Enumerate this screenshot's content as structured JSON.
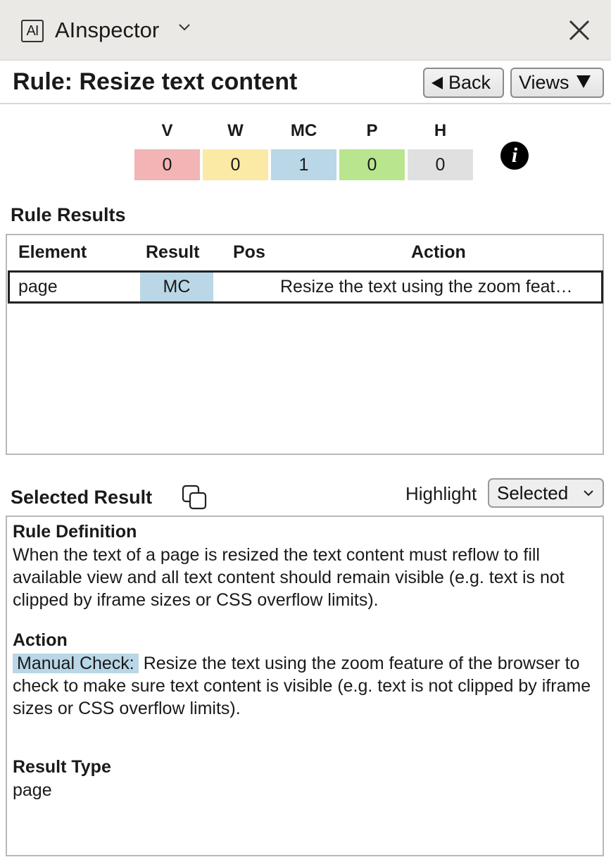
{
  "titlebar": {
    "logo_text": "AI",
    "app_name": "AInspector"
  },
  "header": {
    "title": "Rule: Resize text content",
    "back_label": "Back",
    "views_label": "Views"
  },
  "summary": [
    {
      "label": "V",
      "value": "0",
      "color": "#f2b4b4"
    },
    {
      "label": "W",
      "value": "0",
      "color": "#fbe9a6"
    },
    {
      "label": "MC",
      "value": "1",
      "color": "#b9d7e6"
    },
    {
      "label": "P",
      "value": "0",
      "color": "#b9e58e"
    },
    {
      "label": "H",
      "value": "0",
      "color": "#e0e0e0"
    }
  ],
  "rule_results": {
    "heading": "Rule Results",
    "columns": [
      "Element",
      "Result",
      "Pos",
      "Action"
    ],
    "rows": [
      {
        "element": "page",
        "result": "MC",
        "pos": "",
        "action": "Resize the text using the zoom feat…"
      }
    ]
  },
  "selected_result": {
    "heading": "Selected Result",
    "highlight_label": "Highlight",
    "highlight_value": "Selected"
  },
  "detail": {
    "rule_definition_heading": "Rule Definition",
    "rule_definition_text": "When the text of a page is resized the text content must reflow to fill available view and all text content should remain visible (e.g. text is not clipped by iframe sizes or CSS overflow limits).",
    "action_heading": "Action",
    "action_tag": "Manual Check:",
    "action_text": "Resize the text using the zoom feature of the browser to check to make sure text content is visible (e.g. text is not clipped by iframe sizes or CSS overflow limits).",
    "result_type_heading": "Result Type",
    "result_type_value": "page"
  },
  "icons": {
    "app_chevron": "chevron-down-icon",
    "close": "close-icon",
    "info": "info-icon",
    "copy": "copy-icon",
    "select_chevron": "chevron-down-icon"
  }
}
